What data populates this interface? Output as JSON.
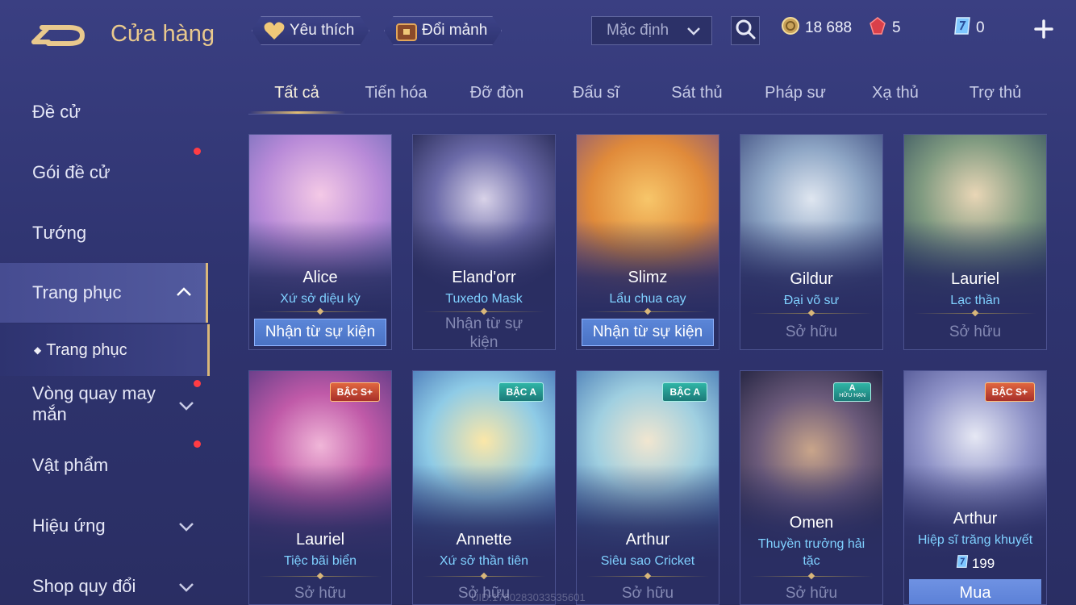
{
  "header": {
    "title": "Cửa hàng",
    "favorites_label": "Yêu thích",
    "exchange_label": "Đổi mảnh",
    "sort": {
      "selected": "Mặc định"
    },
    "currencies": [
      {
        "icon": "gold-coin-icon",
        "value": "18 688"
      },
      {
        "icon": "ruby-icon",
        "value": "5"
      },
      {
        "icon": "voucher-icon",
        "value": "0"
      }
    ]
  },
  "sidebar": {
    "items": [
      {
        "label": "Đề cử"
      },
      {
        "label": "Gói đề cử"
      },
      {
        "label": "Tướng"
      },
      {
        "label": "Trang phục"
      },
      {
        "label": "Trang phục"
      },
      {
        "label": "Vòng quay may mắn"
      },
      {
        "label": "Vật phẩm"
      },
      {
        "label": "Hiệu ứng"
      },
      {
        "label": "Shop quy đổi"
      }
    ]
  },
  "tabs": [
    {
      "label": "Tất cả"
    },
    {
      "label": "Tiến hóa"
    },
    {
      "label": "Đỡ đòn"
    },
    {
      "label": "Đấu sĩ"
    },
    {
      "label": "Sát thủ"
    },
    {
      "label": "Pháp sư"
    },
    {
      "label": "Xạ thủ"
    },
    {
      "label": "Trợ thủ"
    }
  ],
  "cards": [
    {
      "hero": "Alice",
      "skin": "Xứ sở diệu kỳ",
      "status": "Nhận từ sự kiện"
    },
    {
      "hero": "Eland'orr",
      "skin": "Tuxedo Mask",
      "status": "Nhận từ sự kiện"
    },
    {
      "hero": "Slimz",
      "skin": "Lẩu chua cay",
      "status": "Nhận từ sự kiện"
    },
    {
      "hero": "Gildur",
      "skin": "Đại võ sư",
      "status": "Sở hữu"
    },
    {
      "hero": "Lauriel",
      "skin": "Lạc thần",
      "status": "Sở hữu"
    },
    {
      "hero": "Lauriel",
      "skin": "Tiệc bãi biển",
      "status": "Sở hữu",
      "badge": "BẬC S+"
    },
    {
      "hero": "Annette",
      "skin": "Xứ sở thần tiên",
      "status": "Sở hữu",
      "badge": "BẬC A"
    },
    {
      "hero": "Arthur",
      "skin": "Siêu sao Cricket",
      "status": "Sở hữu",
      "badge": "BẬC A"
    },
    {
      "hero": "Omen",
      "skin": "Thuyền trưởng hải tặc",
      "status": "Sở hữu",
      "badge": "A",
      "badge_sub": "HỮU HẠN"
    },
    {
      "hero": "Arthur",
      "skin": "Hiệp sĩ trăng khuyết",
      "price": "199",
      "buy_label": "Mua",
      "badge": "BẬC S+"
    }
  ],
  "watermark": "UID:1760283033535601"
}
